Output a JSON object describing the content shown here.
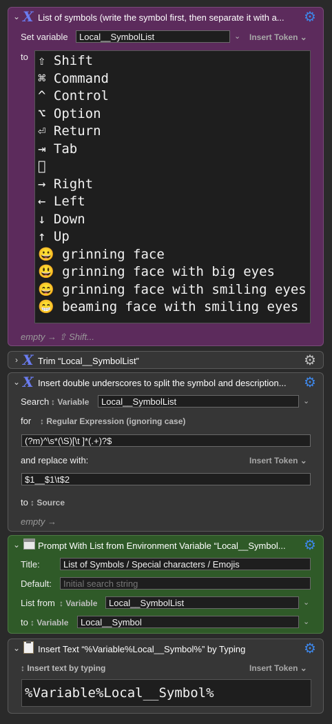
{
  "action1": {
    "title": "List of symbols (write the symbol first, then separate it with a...",
    "set_variable_label": "Set variable",
    "variable_name": "Local__SymbolList",
    "insert_token": "Insert Token ⌄",
    "to_label": "to",
    "symbols": [
      "⇧ Shift",
      "⌘ Command",
      "^ Control",
      "⌥ Option",
      "⏎ Return",
      "⇥ Tab",
      "",
      "→ Right",
      "← Left",
      "↓ Down",
      "↑ Up",
      "😀 grinning face",
      "😃 grinning face with big eyes",
      "😄 grinning face with smiling eyes",
      "😁 beaming face with smiling eyes"
    ],
    "footer": "empty → ⇧ Shift..."
  },
  "action2": {
    "title": "Trim “Local__SymbolList”"
  },
  "action3": {
    "title": "Insert double underscores to split the symbol and description...",
    "search_label": "Search",
    "search_source": "↕ Variable",
    "search_variable": "Local__SymbolList",
    "for_label": "for",
    "for_mode": "↕ Regular Expression (ignoring case)",
    "regex": "(?m)^\\s*(\\S)[\\t ]*(.+)?$",
    "replace_label": "and replace with:",
    "insert_token": "Insert Token ⌄",
    "replacement": "$1__$1\\t$2",
    "to_label": "to",
    "to_target": "↕ Source",
    "footer": "empty →"
  },
  "action4": {
    "title": "Prompt With List from Environment Variable “Local__Symbol...",
    "title_label": "Title:",
    "title_value": "List of Symbols / Special characters / Emojis",
    "default_label": "Default:",
    "default_placeholder": "Initial search string",
    "list_from_label": "List from",
    "list_from_source": "↕ Variable",
    "list_from_value": "Local__SymbolList",
    "to_label": "to",
    "to_source": "↕ Variable",
    "to_value": "Local__Symbol"
  },
  "action5": {
    "title": "Insert Text “%Variable%Local__Symbol%” by Typing",
    "mode": "↕ Insert text by typing",
    "insert_token": "Insert Token ⌄",
    "text": "%Variable%Local__Symbol%"
  },
  "colors": {
    "variable_action": "#5c2b5c",
    "prompt_action": "#2f5a28",
    "gear_enabled": "#3d86e8"
  }
}
